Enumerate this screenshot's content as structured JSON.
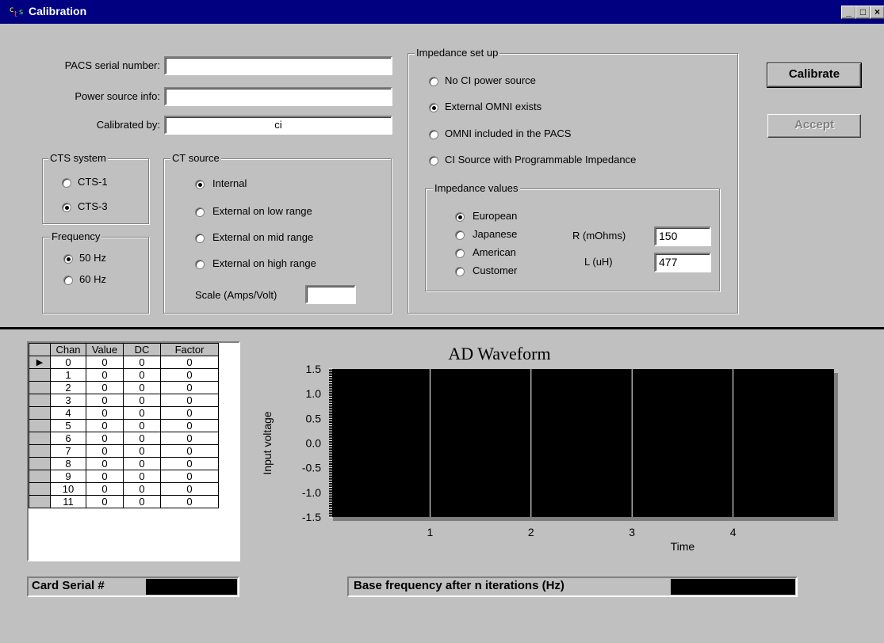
{
  "window": {
    "title": "Calibration",
    "controls": {
      "minimize": "_",
      "maximize": "□",
      "close": "×"
    }
  },
  "form": {
    "pacs_serial_label": "PACS serial number:",
    "pacs_serial_value": "",
    "power_source_label": "Power source info:",
    "power_source_value": "",
    "calibrated_by_label": "Calibrated by:",
    "calibrated_by_value": "ci"
  },
  "cts_system": {
    "title": "CTS system",
    "options": [
      "CTS-1",
      "CTS-3"
    ],
    "selected": "CTS-3"
  },
  "frequency": {
    "title": "Frequency",
    "options": [
      "50 Hz",
      "60 Hz"
    ],
    "selected": "50 Hz"
  },
  "ct_source": {
    "title": "CT source",
    "options": [
      "Internal",
      "External on low range",
      "External on mid range",
      "External on high range"
    ],
    "selected": "Internal",
    "scale_label": "Scale (Amps/Volt)",
    "scale_value": ""
  },
  "impedance_setup": {
    "title": "Impedance set up",
    "options": [
      "No CI power source",
      "External OMNI exists",
      "OMNI included in the PACS",
      "CI Source with Programmable Impedance"
    ],
    "selected": "External OMNI exists"
  },
  "impedance_values": {
    "title": "Impedance values",
    "options": [
      "European",
      "Japanese",
      "American",
      "Customer"
    ],
    "selected": "European",
    "r_label": "R (mOhms)",
    "r_value": "150",
    "l_label": "L (uH)",
    "l_value": "477"
  },
  "buttons": {
    "calibrate": "Calibrate",
    "accept": "Accept"
  },
  "table": {
    "columns": [
      "Chan",
      "Value",
      "DC",
      "Factor"
    ],
    "rows": [
      [
        "0",
        "0",
        "0",
        "0"
      ],
      [
        "1",
        "0",
        "0",
        "0"
      ],
      [
        "2",
        "0",
        "0",
        "0"
      ],
      [
        "3",
        "0",
        "0",
        "0"
      ],
      [
        "4",
        "0",
        "0",
        "0"
      ],
      [
        "5",
        "0",
        "0",
        "0"
      ],
      [
        "6",
        "0",
        "0",
        "0"
      ],
      [
        "7",
        "0",
        "0",
        "0"
      ],
      [
        "8",
        "0",
        "0",
        "0"
      ],
      [
        "9",
        "0",
        "0",
        "0"
      ],
      [
        "10",
        "0",
        "0",
        "0"
      ],
      [
        "11",
        "0",
        "0",
        "0"
      ]
    ],
    "current_row_marker": "▶"
  },
  "card_serial_label": "Card Serial #",
  "base_freq_label": "Base frequency after n iterations (Hz)",
  "colors": {
    "titlebar": "#000080",
    "face": "#c0c0c0",
    "plot_background": "#000000",
    "grid_lines": "#ffffff"
  },
  "chart_data": {
    "type": "line",
    "title": "AD Waveform",
    "xlabel": "Time",
    "ylabel": "Input voltage",
    "xlim": [
      0,
      5
    ],
    "ylim": [
      -1.5,
      1.5
    ],
    "x_ticks": [
      "1",
      "2",
      "3",
      "4"
    ],
    "y_ticks": [
      "1.5",
      "1.0",
      "0.5",
      "0.0",
      "-0.5",
      "-1.0",
      "-1.5"
    ],
    "grid": true,
    "series": []
  }
}
